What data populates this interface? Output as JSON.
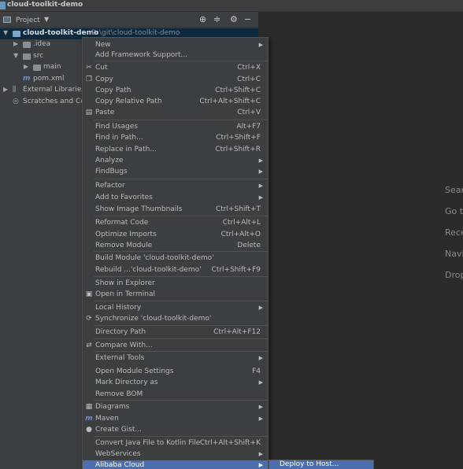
{
  "window": {
    "title": "cloud-toolkit-demo"
  },
  "project_panel": {
    "title": "Project",
    "tree": [
      {
        "kind": "project",
        "name": "cloud-toolkit-demo",
        "path": "D:\\git\\cloud-toolkit-demo"
      },
      {
        "kind": "folder",
        "name": ".idea"
      },
      {
        "kind": "folder",
        "name": "src"
      },
      {
        "kind": "folder",
        "name": "main"
      },
      {
        "kind": "file",
        "name": "pom.xml"
      },
      {
        "kind": "libraries",
        "name": "External Libraries"
      },
      {
        "kind": "scratches",
        "name": "Scratches and Con"
      }
    ]
  },
  "editor_empty": {
    "lines": [
      "Sear",
      "Go t",
      "Rece",
      "Navi",
      "Drop"
    ]
  },
  "context_menu": {
    "items": [
      {
        "label": "New",
        "submenu": true
      },
      {
        "label": "Add Framework Support..."
      },
      {
        "label": "Cut",
        "shortcut": "Ctrl+X",
        "icon": "✂"
      },
      {
        "label": "Copy",
        "shortcut": "Ctrl+C",
        "icon": "❐"
      },
      {
        "label": "Copy Path",
        "shortcut": "Ctrl+Shift+C"
      },
      {
        "label": "Copy Relative Path",
        "shortcut": "Ctrl+Alt+Shift+C"
      },
      {
        "label": "Paste",
        "shortcut": "Ctrl+V",
        "icon": "▤"
      },
      {
        "label": "Find Usages",
        "shortcut": "Alt+F7"
      },
      {
        "label": "Find in Path...",
        "shortcut": "Ctrl+Shift+F"
      },
      {
        "label": "Replace in Path...",
        "shortcut": "Ctrl+Shift+R"
      },
      {
        "label": "Analyze",
        "submenu": true
      },
      {
        "label": "FindBugs",
        "submenu": true
      },
      {
        "label": "Refactor",
        "submenu": true
      },
      {
        "label": "Add to Favorites",
        "submenu": true
      },
      {
        "label": "Show Image Thumbnails",
        "shortcut": "Ctrl+Shift+T"
      },
      {
        "label": "Reformat Code",
        "shortcut": "Ctrl+Alt+L"
      },
      {
        "label": "Optimize Imports",
        "shortcut": "Ctrl+Alt+O"
      },
      {
        "label": "Remove Module",
        "shortcut": "Delete"
      },
      {
        "label": "Build Module 'cloud-toolkit-demo'"
      },
      {
        "label": "Rebuild ...'cloud-toolkit-demo'",
        "shortcut": "Ctrl+Shift+F9"
      },
      {
        "label": "Show in Explorer"
      },
      {
        "label": "Open in Terminal",
        "icon": "▣"
      },
      {
        "label": "Local History",
        "submenu": true
      },
      {
        "label": "Synchronize 'cloud-toolkit-demo'",
        "icon": "⟳"
      },
      {
        "label": "Directory Path",
        "shortcut": "Ctrl+Alt+F12"
      },
      {
        "label": "Compare With...",
        "icon": "⇄"
      },
      {
        "label": "External Tools",
        "submenu": true
      },
      {
        "label": "Open Module Settings",
        "shortcut": "F4"
      },
      {
        "label": "Mark Directory as",
        "submenu": true
      },
      {
        "label": "Remove BOM"
      },
      {
        "label": "Diagrams",
        "submenu": true,
        "icon": "▦"
      },
      {
        "label": "Maven",
        "submenu": true,
        "icon": "m"
      },
      {
        "label": "Create Gist...",
        "icon": "●"
      },
      {
        "label": "Convert Java File to Kotlin File",
        "shortcut": "Ctrl+Alt+Shift+K"
      },
      {
        "label": "WebServices",
        "submenu": true
      },
      {
        "label": "Alibaba Cloud",
        "submenu": true
      }
    ],
    "submenu": {
      "label": "Deploy to Host..."
    }
  },
  "colors": {
    "accent": "#4b6eaf",
    "menu_bg": "#3c3f41",
    "editor_bg": "#2b2b2b"
  }
}
